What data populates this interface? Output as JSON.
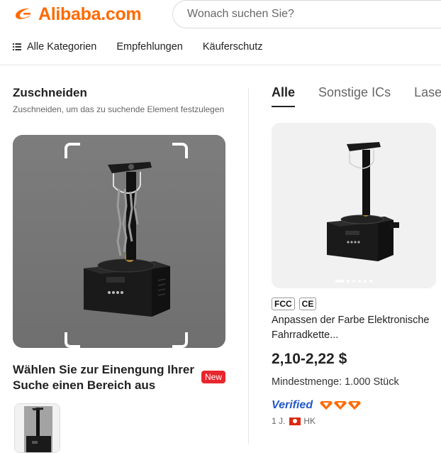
{
  "header": {
    "logo_text": "Alibaba.com",
    "brand_color": "#ff6a00",
    "search_placeholder": "Wonach suchen Sie?"
  },
  "nav": {
    "items": [
      "Alle Kategorien",
      "Empfehlungen",
      "Käuferschutz"
    ]
  },
  "crop_panel": {
    "title": "Zuschneiden",
    "subtitle": "Zuschneiden, um das zu suchende Element festzulegen",
    "narrow_text": "Wählen Sie zur Einengung Ihrer Suche einen Bereich aus",
    "new_badge": "New"
  },
  "results": {
    "tabs": [
      "Alle",
      "Sonstige ICs",
      "Lase"
    ],
    "active_tab": "Alle",
    "product": {
      "certs": [
        "FCC",
        "CE"
      ],
      "title": "Anpassen der Farbe Elektronische Fahrradkette...",
      "price": "2,10-2,22 $",
      "moq": "Mindestmenge: 1.000 Stück",
      "verified_label": "Verified",
      "years": "1 J.",
      "country": "HK"
    }
  }
}
